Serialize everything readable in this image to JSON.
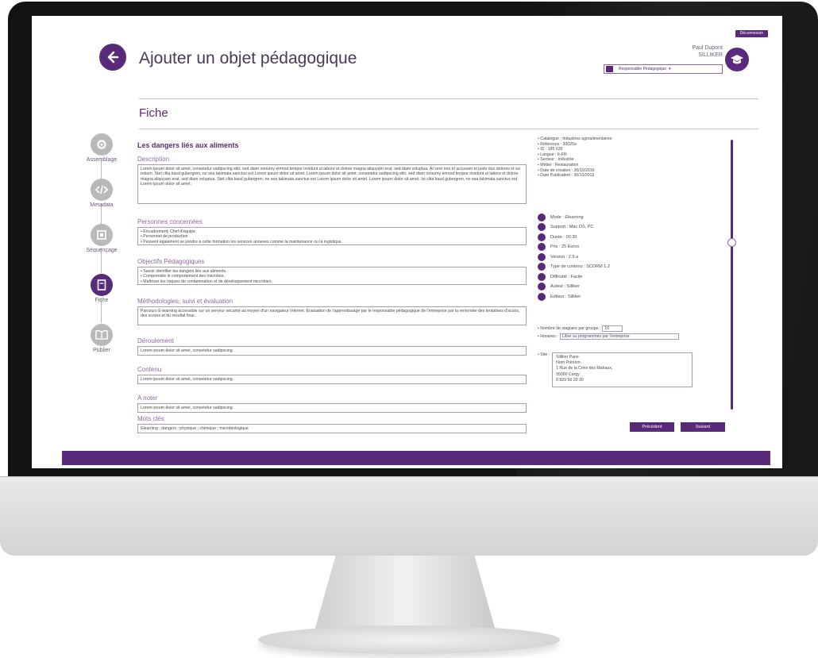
{
  "header": {
    "badge": "Déconnexion",
    "title": "Ajouter un objet pédagogique",
    "user_name": "Paul Dupont",
    "user_org": "SILLIKER",
    "role": "Responsable Pédagogique"
  },
  "section": {
    "title": "Fiche"
  },
  "steps": [
    {
      "label": "Assemblage"
    },
    {
      "label": "Metadata"
    },
    {
      "label": "Séquençage"
    },
    {
      "label": "Fiche"
    },
    {
      "label": "Publier"
    }
  ],
  "form": {
    "object_title": "Les dangers liés aux aliments",
    "description": {
      "label": "Description",
      "value": "Lorem ipsum dolor sit amet, consetetur sadipscing elitr, sed diam nonumy eirmod tempor invidunt ut labore et dolore magna aliquyam erat, sed diam voluptua. At vero eos et accusam et justo duo dolores et ea rebum. Stet clita kasd gubergren, no sea takimata sanctus est Lorem ipsum dolor sit amet. Lorem ipsum dolor sit amet, consetetur sadipscing elitr, sed diam nonumy eirmod tempor invidunt ut labore et dolore magna aliquyam erat, sed diam voluptua. Stet clita kasd gubergren, no sea takimata sanctus est Lorem ipsum dolor sit amet. Lorem ipsum dolor sit amet. Ist clita kasd gubergren, no sea takimata sanctus est Lorem ipsum dolor sit amet."
    },
    "personnes": {
      "label": "Personnes concernées",
      "items": [
        "Encadrement, Chef d'équipe",
        "Personnel de production",
        "Peuvent également se joindre à cette formation les services annexes comme la maintenance ou la logistique."
      ]
    },
    "objectifs": {
      "label": "Objectifs Pédagogiques",
      "items": [
        "Savoir identifier les dangers liés aux aliments.",
        "Comprendre le comportement des microbes.",
        "Maîtriser les risques de contamination et de développement microbien."
      ]
    },
    "methodologies": {
      "label": "Méthodologies, suivi et évaluation",
      "value": "Parcours E-learning accessible sur un serveur sécurité au moyen d'un navigateur Internet. Evaluation de l'apprentissage par le responsable pédagogique de l'entreprise par la remontée des tentatives d'accès, des scores et du résultat final."
    },
    "deroulement": {
      "label": "Déroulement",
      "value": "Lorem ipsum dolor sit amet, consetetur sadipscing."
    },
    "contenu": {
      "label": "Contenu",
      "value": "Lorem ipsum dolor sit amet, consetetur sadipscing."
    },
    "a_noter": {
      "label": "A noter",
      "value": "Lorem ipsum dolor sit amet, consetetur sadipscing."
    },
    "mots_cles": {
      "label": "Mots clés",
      "value": "Elearning ; dangers ; physique ; chimique ; microbiologique"
    }
  },
  "meta_list": [
    "Catalogue : Industries agroalimentaires",
    "Référence : 30025a",
    "ID : 185 630",
    "Langue : fr-FR",
    "Secteur : Industrie",
    "Métier : Restauration",
    "Date de création : 30/10/2016",
    "Date Publication : 30/10/2016"
  ],
  "icon_rows": [
    "Mode : Elearning",
    "Support : Mac OS, PC",
    "Durée : 00:30",
    "Prix : 25 Euros",
    "Version : 2.9.a",
    "Type de contenu : SCORM 1.2",
    "Difficulté : Facile",
    "Auteur : Silliker",
    "Editeur : Silliker"
  ],
  "small_fields": {
    "stagiaires_label": "Nombre de stagiaire par groupe :",
    "stagiaires_value": "10",
    "horaires_label": "Horaires :",
    "horaires_value": "Libre ou programmes par l'entreprise"
  },
  "site": {
    "label": "Site :",
    "lines": [
      "Silliker Paris",
      "Nom Prénom",
      "1 Rue de la Croix des Mahaux,",
      "95000 Cergy",
      "0 820 56 20 30"
    ]
  },
  "buttons": {
    "prev": "Précédent",
    "next": "Suivant"
  },
  "colors": {
    "accent": "#5a2a7a",
    "inactive": "#b9b9b9"
  }
}
